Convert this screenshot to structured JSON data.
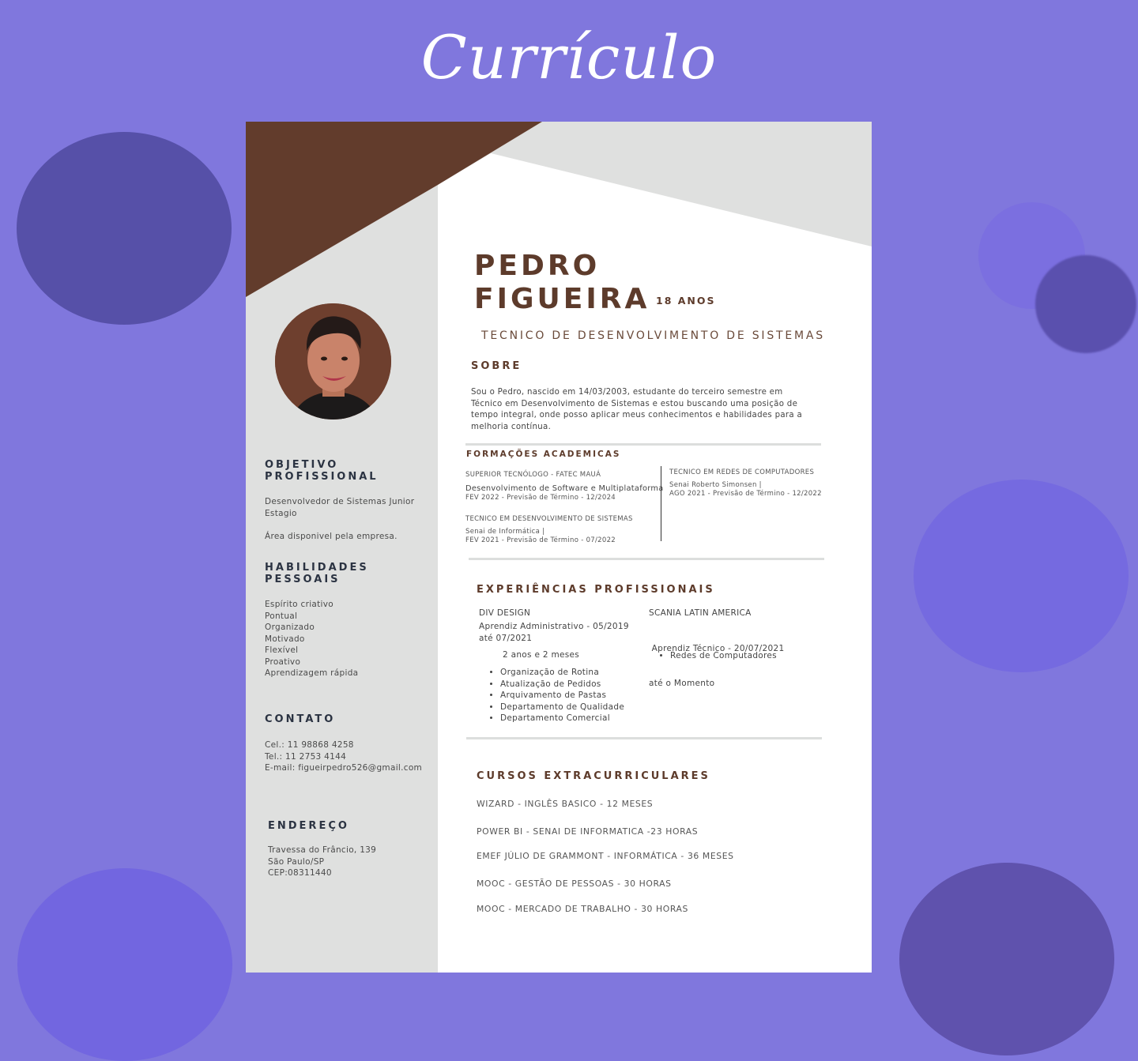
{
  "header": {
    "title": "Currículo"
  },
  "colors": {
    "background": "#8077dd",
    "accent_brown": "#623c2c",
    "panel_gray": "#dfe0df",
    "heading_navy": "#2b3342"
  },
  "resume": {
    "name_line1": "PEDRO",
    "name_line2": "FIGUEIRA",
    "age": "18 ANOS",
    "role": "TECNICO DE DESENVOLVIMENTO DE SISTEMAS",
    "photo_icon": "profile-photo",
    "sidebar": {
      "objective_title_1": "OBJETIVO",
      "objective_title_2": "PROFISSIONAL",
      "objective_lines": [
        "Desenvolvedor de Sistemas Junior",
        "Estagio",
        "",
        "Área disponivel pela empresa."
      ],
      "skills_title_1": "HABILIDADES",
      "skills_title_2": "PESSOAIS",
      "skills": [
        "Espírito criativo",
        "Pontual",
        "Organizado",
        "Motivado",
        "Flexível",
        "Proativo",
        "Aprendizagem rápida"
      ],
      "contact_title": "CONTATO",
      "contact_lines": [
        "Cel.: 11 98868 4258",
        "Tel.: 11 2753 4144",
        "E-mail: figueirpedro526@gmail.com"
      ],
      "address_title": "ENDEREÇO",
      "address_lines": [
        "Travessa do Frâncio, 139",
        "São Paulo/SP",
        "CEP:08311440"
      ]
    },
    "about": {
      "title": "SOBRE",
      "lines": [
        "Sou o Pedro, nascido em 14/03/2003, estudante do terceiro semestre em",
        "Técnico em Desenvolvimento de Sistemas e estou buscando uma posição de",
        "tempo integral, onde posso aplicar meus conhecimentos e habilidades para a",
        "melhoria contínua."
      ]
    },
    "education": {
      "title": "FORMAÇÕES ACADEMICAS",
      "items": [
        {
          "head": "SUPERIOR TECNÓLOGO - FATEC MAUÁ",
          "course": "Desenvolvimento de Software e Multiplataforma",
          "dates": "FEV 2022 -  Previsão de Término - 12/2024"
        },
        {
          "head": "TECNICO EM DESENVOLVIMENTO DE SISTEMAS",
          "school": "Senai de Informática |",
          "dates": "FEV 2021 - Previsão de Término - 07/2022"
        },
        {
          "head": "TECNICO EM REDES DE COMPUTADORES",
          "school": "Senai Roberto Simonsen |",
          "dates": " AGO 2021 - Previsão de Término - 12/2022"
        }
      ]
    },
    "experience": {
      "title": "EXPERIÊNCIAS PROFISSIONAIS",
      "jobs": [
        {
          "company": "DIV DESIGN",
          "role_line1": "Aprendiz Administrativo - 05/2019",
          "role_line2": "até 07/2021",
          "duration": "2 anos e 2 meses",
          "tasks": [
            "Organização de Rotina",
            "Atualização de Pedidos",
            "Arquivamento de Pastas",
            "Departamento de Qualidade",
            "Departamento Comercial"
          ]
        },
        {
          "company": "SCANIA LATIN AMERICA",
          "role_line1": " Aprendiz Técnico - 20/07/2021",
          "role_line2": "até o Momento",
          "tasks": [
            "Redes de Computadores"
          ]
        }
      ]
    },
    "courses": {
      "title": "CURSOS EXTRACURRICULARES",
      "items": [
        "WIZARD - INGLÊS BASICO - 12 MESES",
        "POWER BI - SENAI DE INFORMATICA -23 HORAS",
        "EMEF JÚLIO DE GRAMMONT - INFORMÁTICA - 36 MESES",
        "MOOC - GESTÃO DE PESSOAS - 30 HORAS",
        "MOOC - MERCADO DE TRABALHO - 30 HORAS"
      ]
    }
  }
}
